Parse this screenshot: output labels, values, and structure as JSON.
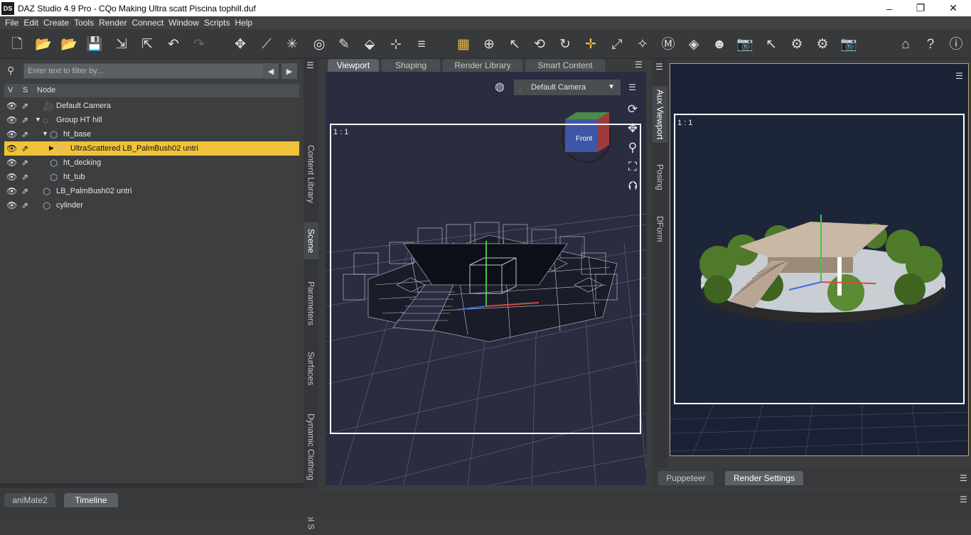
{
  "window": {
    "logo": "DS",
    "title": "DAZ Studio 4.9 Pro - CQo Making Ultra scatt Piscina tophill.duf",
    "minimize": "–",
    "restore": "❐",
    "close": "✕"
  },
  "menu": [
    "File",
    "Edit",
    "Create",
    "Tools",
    "Render",
    "Connect",
    "Window",
    "Scripts",
    "Help"
  ],
  "toolbar_icons": [
    "new-file-icon",
    "open-icon",
    "open-recent-icon",
    "save-icon",
    "import-icon",
    "export-icon",
    "undo-icon",
    "redo-icon",
    "universal-tool-icon",
    "joint-editor-icon",
    "spot-light-icon",
    "node-weight-icon",
    "geometry-editor-icon",
    "transform-icon",
    "region-navigator-icon",
    "align-icon",
    "active-pose-icon",
    "orbit-icon",
    "select-icon",
    "rotate-view-icon",
    "rotate-icon",
    "translate-icon",
    "scale-icon",
    "surface-selection-icon",
    "morph-icon",
    "node-icon",
    "figure-icon",
    "camera-icon",
    "light-select-icon",
    "render-settings-icon",
    "render-icon",
    "render-camera-icon",
    "daz-home-icon",
    "whats-this-icon",
    "help-icon"
  ],
  "scene": {
    "search_placeholder": "Enter text to filter by...",
    "columns": {
      "v": "V",
      "s": "S",
      "node": "Node"
    },
    "nodes": [
      {
        "label": "Default Camera",
        "indent": 0,
        "arrow": "",
        "icon": "camera"
      },
      {
        "label": "Group HT hill",
        "indent": 0,
        "arrow": "▼",
        "icon": "group"
      },
      {
        "label": "ht_base",
        "indent": 1,
        "arrow": "▼",
        "icon": "prop"
      },
      {
        "label": "UltraScattered LB_PalmBush02 untri",
        "indent": 2,
        "arrow": "▶",
        "icon": "ultrascatter",
        "selected": true
      },
      {
        "label": "ht_decking",
        "indent": 1,
        "arrow": "",
        "icon": "prop"
      },
      {
        "label": "ht_tub",
        "indent": 1,
        "arrow": "",
        "icon": "prop"
      },
      {
        "label": "LB_PalmBush02 untri",
        "indent": 0,
        "arrow": "",
        "icon": "prop"
      },
      {
        "label": "cylinder",
        "indent": 0,
        "arrow": "",
        "icon": "prop"
      }
    ]
  },
  "side_tabs_left": [
    "Content Library",
    "Scene",
    "Parameters",
    "Surfaces",
    "Dynamic Clothing",
    "Tool S"
  ],
  "viewport": {
    "tabs": [
      "Viewport",
      "Shaping",
      "Render Library",
      "Smart Content"
    ],
    "active_tab": "Viewport",
    "camera": "Default Camera",
    "aspect": "1 : 1",
    "cube_label": "Front"
  },
  "side_tabs_right": [
    "Aux Viewport",
    "Posing",
    "DForm"
  ],
  "aux": {
    "aspect": "1 : 1"
  },
  "right_bottom_tabs": [
    "Puppeteer",
    "Render Settings"
  ],
  "right_bottom_active": "Render Settings",
  "bottom_tabs": [
    "aniMate2",
    "Timeline"
  ],
  "bottom_active": "Timeline",
  "colors": {
    "selection": "#f0c23a",
    "viewport_bg": "#2a2d40",
    "aux_border": "#b8a56b"
  }
}
